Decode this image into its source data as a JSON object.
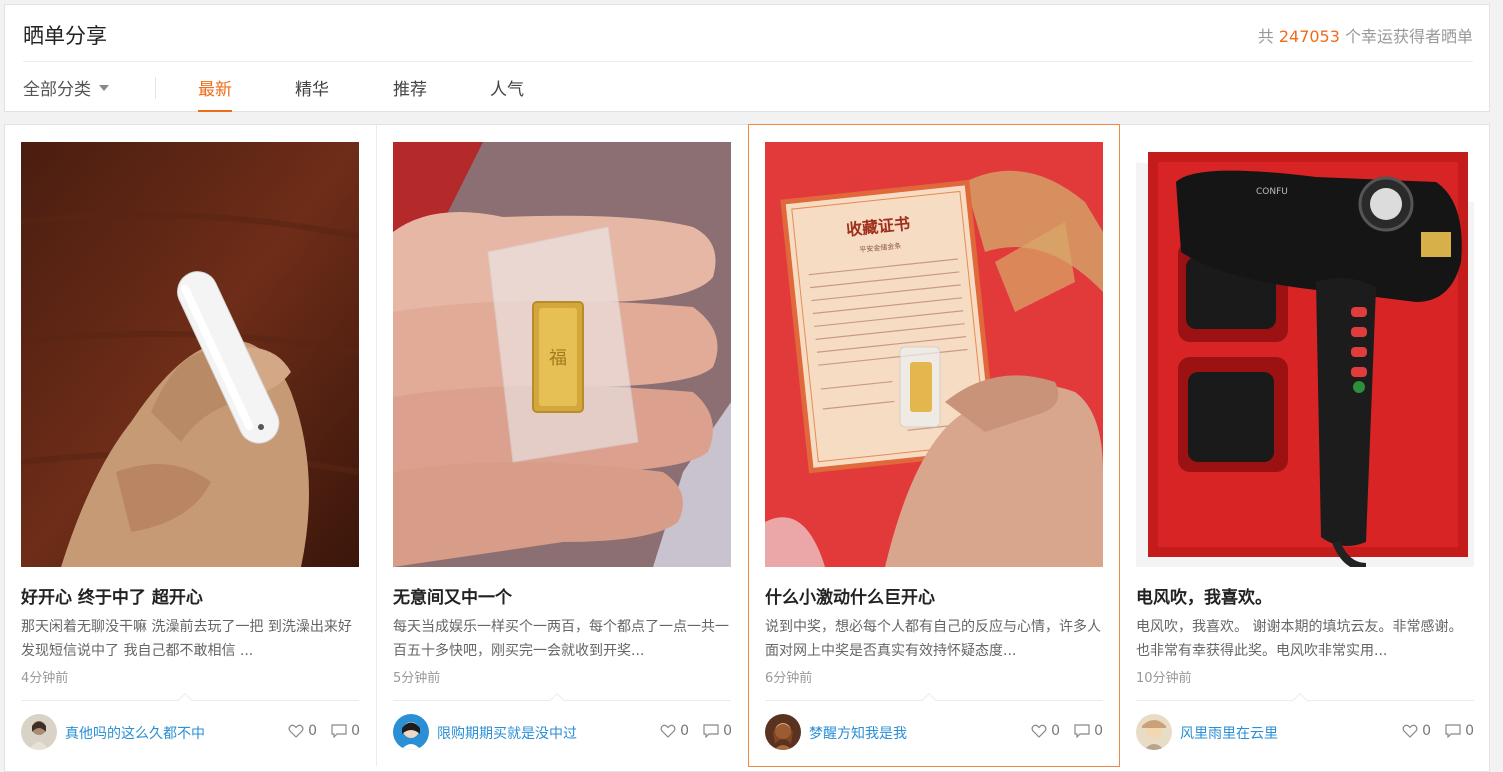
{
  "header": {
    "title": "晒单分享",
    "count_prefix": "共 ",
    "count": "247053",
    "count_suffix": " 个幸运获得者晒单",
    "category": "全部分类",
    "tabs": [
      "最新",
      "精华",
      "推荐",
      "人气"
    ],
    "active_tab": "最新"
  },
  "posts": [
    {
      "title": "好开心 终于中了 超开心",
      "desc": "那天闲着无聊没干嘛 洗澡前去玩了一把 到洗澡出来好发现短信说中了 我自己都不敢相信 ...",
      "time": "4分钟前",
      "user": "真他吗的这么久都不中",
      "likes": "0",
      "comments": "0",
      "photo": "white-bluetooth-earpiece-in-hand"
    },
    {
      "title": "无意间又中一个",
      "desc": "每天当成娱乐一样买个一两百，每个都点了一点一共一百五十多快吧，刚买完一会就收到开奖...",
      "time": "5分钟前",
      "user": "限购期期买就是没中过",
      "likes": "0",
      "comments": "0",
      "photo": "small-gold-bar-in-hand"
    },
    {
      "title": "什么小激动什么巨开心",
      "desc": "说到中奖，想必每个人都有自己的反应与心情，许多人面对网上中奖是否真实有效持怀疑态度...",
      "time": "6分钟前",
      "user": "梦醒方知我是我",
      "likes": "0",
      "comments": "0",
      "photo": "gold-bar-with-certificate"
    },
    {
      "title": "电风吹，我喜欢。",
      "desc": "电风吹，我喜欢。 谢谢本期的填坑云友。非常感谢。也非常有幸获得此奖。电风吹非常实用...",
      "time": "10分钟前",
      "user": "风里雨里在云里",
      "likes": "0",
      "comments": "0",
      "photo": "hair-dryer-in-red-box"
    }
  ],
  "colors": {
    "accent": "#ef6c1a",
    "link": "#2a8fd5"
  }
}
